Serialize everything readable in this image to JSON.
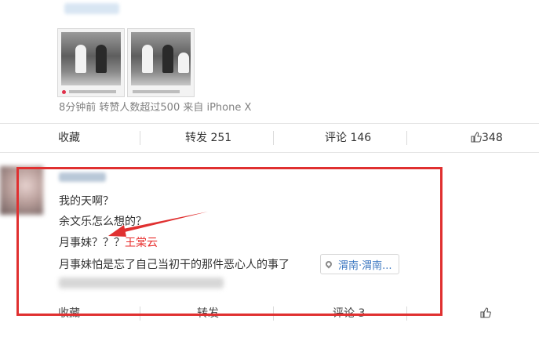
{
  "post": {
    "meta_text": "8分钟前 转赞人数超过500 来自 iPhone X",
    "actions": {
      "favorite": "收藏",
      "repost": "转发 251",
      "comment": "评论 146",
      "like": "348"
    }
  },
  "comment": {
    "lines": [
      "我的天啊？",
      "余文乐怎么想的？"
    ],
    "line3_prefix": "月事妹？？？",
    "mention": "王棠云",
    "line4": "月事妹怕是忘了自己当初干的那件恶心人的事了",
    "location": "渭南·渭南...",
    "actions": {
      "favorite": "收藏",
      "repost": "转发",
      "comment": "评论 3"
    }
  },
  "colors": {
    "highlight": "#e03030",
    "mention": "#e8302f",
    "link": "#3a76c0"
  }
}
